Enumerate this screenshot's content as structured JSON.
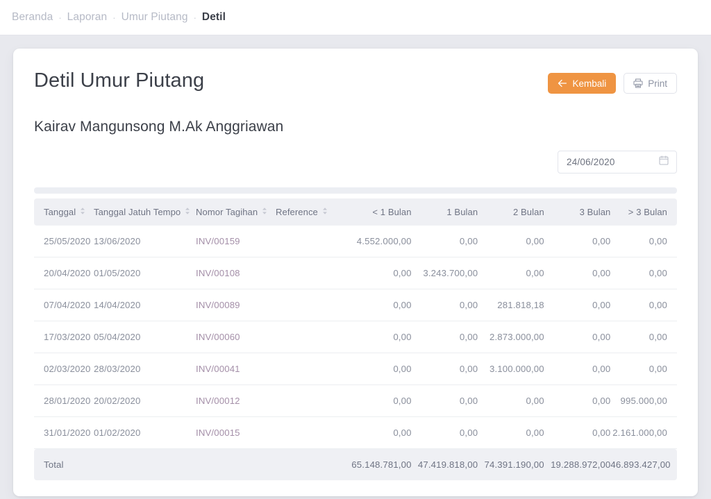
{
  "breadcrumb": {
    "items": [
      {
        "label": "Beranda",
        "active": false
      },
      {
        "label": "Laporan",
        "active": false
      },
      {
        "label": "Umur Piutang",
        "active": false
      },
      {
        "label": "Detil",
        "active": true
      }
    ],
    "separator": "·"
  },
  "header": {
    "title": "Detil Umur Piutang",
    "subtitle": "Kairav Mangunsong M.Ak Anggriawan",
    "back_label": "Kembali",
    "back_icon": "arrow-left-icon",
    "print_label": "Print",
    "print_icon": "printer-icon",
    "accent_color": "#ef9442"
  },
  "filter": {
    "date_value": "24/06/2020",
    "date_placeholder": "dd/mm/yyyy",
    "calendar_icon": "calendar-icon"
  },
  "table": {
    "columns": [
      {
        "label": "Tanggal",
        "align": "left",
        "sortable": true
      },
      {
        "label": "Tanggal Jatuh Tempo",
        "align": "left",
        "sortable": true
      },
      {
        "label": "Nomor Tagihan",
        "align": "left",
        "sortable": true
      },
      {
        "label": "Reference",
        "align": "left",
        "sortable": true
      },
      {
        "label": "< 1 Bulan",
        "align": "right",
        "sortable": false
      },
      {
        "label": "1 Bulan",
        "align": "right",
        "sortable": false
      },
      {
        "label": "2 Bulan",
        "align": "right",
        "sortable": false
      },
      {
        "label": "3 Bulan",
        "align": "right",
        "sortable": false
      },
      {
        "label": "> 3 Bulan",
        "align": "right",
        "sortable": false
      }
    ],
    "rows": [
      {
        "tanggal": "25/05/2020",
        "jatuh_tempo": "13/06/2020",
        "nomor": "INV/00159",
        "reference": "",
        "b0": "4.552.000,00",
        "b1": "0,00",
        "b2": "0,00",
        "b3": "0,00",
        "b4": "0,00"
      },
      {
        "tanggal": "20/04/2020",
        "jatuh_tempo": "01/05/2020",
        "nomor": "INV/00108",
        "reference": "",
        "b0": "0,00",
        "b1": "3.243.700,00",
        "b2": "0,00",
        "b3": "0,00",
        "b4": "0,00"
      },
      {
        "tanggal": "07/04/2020",
        "jatuh_tempo": "14/04/2020",
        "nomor": "INV/00089",
        "reference": "",
        "b0": "0,00",
        "b1": "0,00",
        "b2": "281.818,18",
        "b3": "0,00",
        "b4": "0,00"
      },
      {
        "tanggal": "17/03/2020",
        "jatuh_tempo": "05/04/2020",
        "nomor": "INV/00060",
        "reference": "",
        "b0": "0,00",
        "b1": "0,00",
        "b2": "2.873.000,00",
        "b3": "0,00",
        "b4": "0,00"
      },
      {
        "tanggal": "02/03/2020",
        "jatuh_tempo": "28/03/2020",
        "nomor": "INV/00041",
        "reference": "",
        "b0": "0,00",
        "b1": "0,00",
        "b2": "3.100.000,00",
        "b3": "0,00",
        "b4": "0,00"
      },
      {
        "tanggal": "28/01/2020",
        "jatuh_tempo": "20/02/2020",
        "nomor": "INV/00012",
        "reference": "",
        "b0": "0,00",
        "b1": "0,00",
        "b2": "0,00",
        "b3": "0,00",
        "b4": "995.000,00"
      },
      {
        "tanggal": "31/01/2020",
        "jatuh_tempo": "01/02/2020",
        "nomor": "INV/00015",
        "reference": "",
        "b0": "0,00",
        "b1": "0,00",
        "b2": "0,00",
        "b3": "0,00",
        "b4": "2.161.000,00"
      }
    ],
    "footer": {
      "label": "Total",
      "b0": "65.148.781,00",
      "b1": "47.419.818,00",
      "b2": "74.391.190,00",
      "b3": "19.288.972,00",
      "b4": "46.893.427,00"
    }
  }
}
